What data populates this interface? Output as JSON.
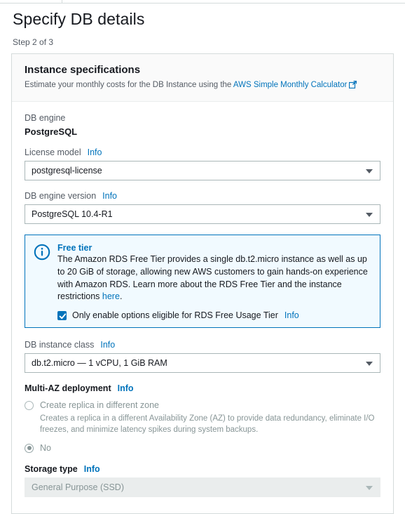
{
  "page": {
    "title": "Specify DB details",
    "step": "Step 2 of 3"
  },
  "card": {
    "title": "Instance specifications",
    "subtitle_prefix": "Estimate your monthly costs for the DB Instance using the ",
    "calculator_link": "AWS Simple Monthly Calculator",
    "external_link_icon": "external-link-icon"
  },
  "fields": {
    "db_engine": {
      "label": "DB engine",
      "value": "PostgreSQL"
    },
    "license_model": {
      "label": "License model",
      "info": "Info",
      "value": "postgresql-license",
      "caret_icon": "chevron-down-icon"
    },
    "db_engine_version": {
      "label": "DB engine version",
      "info": "Info",
      "value": "PostgreSQL 10.4-R1",
      "caret_icon": "chevron-down-icon"
    },
    "db_instance_class": {
      "label": "DB instance class",
      "info": "Info",
      "value": "db.t2.micro — 1 vCPU, 1 GiB RAM",
      "caret_icon": "chevron-down-icon"
    },
    "multi_az": {
      "label": "Multi-AZ deployment",
      "info": "Info",
      "options": [
        {
          "label": "Create replica in different zone",
          "description": "Creates a replica in a different Availability Zone (AZ) to provide data redundancy, eliminate I/O freezes, and minimize latency spikes during system backups.",
          "selected": false,
          "disabled": true
        },
        {
          "label": "No",
          "description": "",
          "selected": true,
          "disabled": true
        }
      ]
    },
    "storage_type": {
      "label": "Storage type",
      "info": "Info",
      "value": "General Purpose (SSD)",
      "disabled": true,
      "caret_icon": "chevron-down-icon"
    }
  },
  "free_tier": {
    "icon": "info-circle-icon",
    "title": "Free tier",
    "body_text": "The Amazon RDS Free Tier provides a single db.t2.micro instance as well as up to 20 GiB of storage, allowing new AWS customers to gain hands-on experience with Amazon RDS. Learn more about the RDS Free Tier and the instance restrictions ",
    "here_link": "here",
    "body_suffix": ".",
    "checkbox": {
      "checked": true,
      "label": "Only enable options eligible for RDS Free Usage Tier",
      "info": "Info",
      "check_icon": "check-icon"
    }
  },
  "colors": {
    "accent_blue": "#0073bb",
    "text_dark": "#16191f",
    "text_muted": "#545b64",
    "text_disabled": "#879596",
    "border": "#d5dbdb",
    "alert_bg": "#f1faff"
  }
}
